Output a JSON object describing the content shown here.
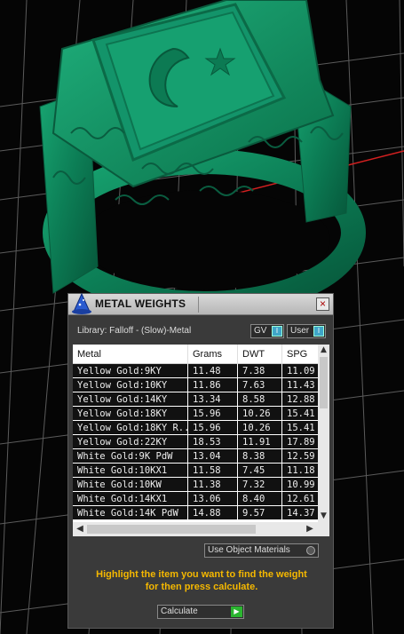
{
  "dialog": {
    "title": "METAL WEIGHTS",
    "close_label": "×",
    "library_label": "Library: Falloff - (Slow)-Metal",
    "gv_label": "GV",
    "user_label": "User",
    "toggle_knob": "I"
  },
  "table": {
    "headers": [
      "Metal",
      "Grams",
      "DWT",
      "SPG"
    ],
    "rows": [
      [
        "Yellow Gold:9KY",
        "11.48",
        "7.38",
        "11.09"
      ],
      [
        "Yellow Gold:10KY",
        "11.86",
        "7.63",
        "11.43"
      ],
      [
        "Yellow Gold:14KY",
        "13.34",
        "8.58",
        "12.88"
      ],
      [
        "Yellow Gold:18KY",
        "15.96",
        "10.26",
        "15.41"
      ],
      [
        "Yellow Gold:18KY R...",
        "15.96",
        "10.26",
        "15.41"
      ],
      [
        "Yellow Gold:22KY",
        "18.53",
        "11.91",
        "17.89"
      ],
      [
        "White Gold:9K PdW",
        "13.04",
        "8.38",
        "12.59"
      ],
      [
        "White Gold:10KX1",
        "11.58",
        "7.45",
        "11.18"
      ],
      [
        "White Gold:10KW",
        "11.38",
        "7.32",
        "10.99"
      ],
      [
        "White Gold:14KX1",
        "13.06",
        "8.40",
        "12.61"
      ],
      [
        "White Gold:14K PdW",
        "14.88",
        "9.57",
        "14.37"
      ]
    ],
    "scroll_up": "▲",
    "scroll_down": "▼",
    "scroll_left": "◀",
    "scroll_right": "▶"
  },
  "options": {
    "use_object_materials": "Use Object Materials"
  },
  "hint": {
    "line1": "Highlight the item you want to find the weight",
    "line2": "for then press calculate."
  },
  "actions": {
    "calculate_label": "Calculate",
    "calculate_icon": "▶"
  },
  "colors": {
    "ring": "#0f8a5f",
    "hint": "#f5b800",
    "axis": "#d42020"
  }
}
